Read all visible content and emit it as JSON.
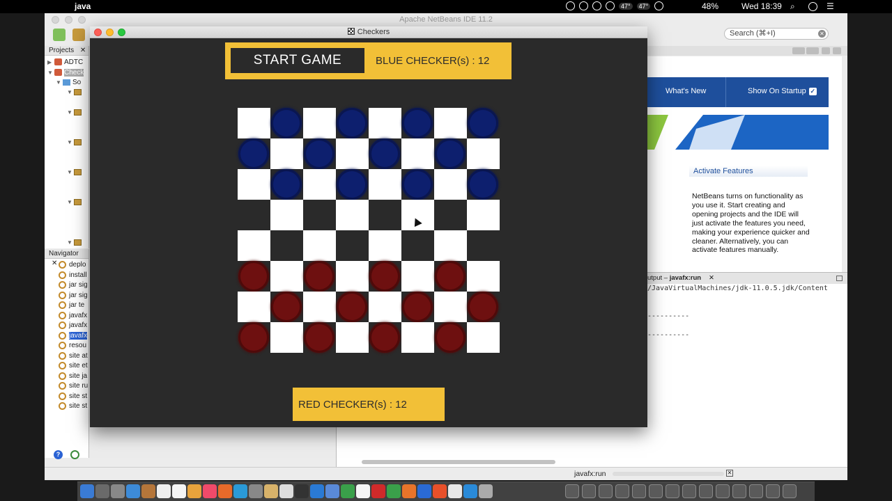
{
  "menubar": {
    "app_name": "java",
    "temp1": "47°",
    "temp2": "47°",
    "battery": "48%",
    "clock": "Wed 18:39"
  },
  "netbeans": {
    "title": "Apache NetBeans IDE 11.2",
    "search_placeholder": "Search (⌘+I)",
    "projects_tab": "Projects",
    "project_items": [
      "ADTC",
      "Check",
      "So"
    ],
    "navigator_tab": "Navigator",
    "navigator_items": [
      "deplo",
      "install",
      "jar sig",
      "jar sig",
      "jar te",
      "javafx",
      "javafx",
      "javafx",
      "resou",
      "site at",
      "site et",
      "site ja",
      "site ru",
      "site st",
      "site st"
    ],
    "start_page": {
      "whats_new": "What's New",
      "show_on_startup": "Show On Startup",
      "activate_features": "Activate Features",
      "description": "NetBeans turns on functionality as you use it. Start creating and opening projects and the IDE will just activate the features you need, making your experience quicker and cleaner. Alternatively, you can activate features manually."
    },
    "output": {
      "tab_prefix": "utput – ",
      "tab_name": "javafx:run",
      "lines": [
        "/JavaVirtualMachines/jdk-11.0.5.jdk/Content",
        "----------",
        "----------"
      ]
    },
    "status_run": "javafx:run"
  },
  "checkers": {
    "window_title": "Checkers",
    "start_button": "START GAME",
    "blue_label": "BLUE CHECKER(s)  : 12",
    "red_label": "RED CHECKER(s) :  12",
    "board": [
      [
        "",
        "B",
        "",
        "B",
        "",
        "B",
        "",
        "B"
      ],
      [
        "B",
        "",
        "B",
        "",
        "B",
        "",
        "B",
        ""
      ],
      [
        "",
        "B",
        "",
        "B",
        "",
        "B",
        "",
        "B"
      ],
      [
        "",
        "",
        "",
        "",
        "",
        "",
        "",
        ""
      ],
      [
        "",
        "",
        "",
        "",
        "",
        "",
        "",
        ""
      ],
      [
        "R",
        "",
        "R",
        "",
        "R",
        "",
        "R",
        ""
      ],
      [
        "",
        "R",
        "",
        "R",
        "",
        "R",
        "",
        "R"
      ],
      [
        "R",
        "",
        "R",
        "",
        "R",
        "",
        "R",
        ""
      ]
    ],
    "colors": {
      "panel": "#f2c037",
      "blue_piece": "#0d1f6e",
      "red_piece": "#6e1010",
      "dark_square": "#2a2a2a",
      "light_square": "#ffffff"
    }
  }
}
